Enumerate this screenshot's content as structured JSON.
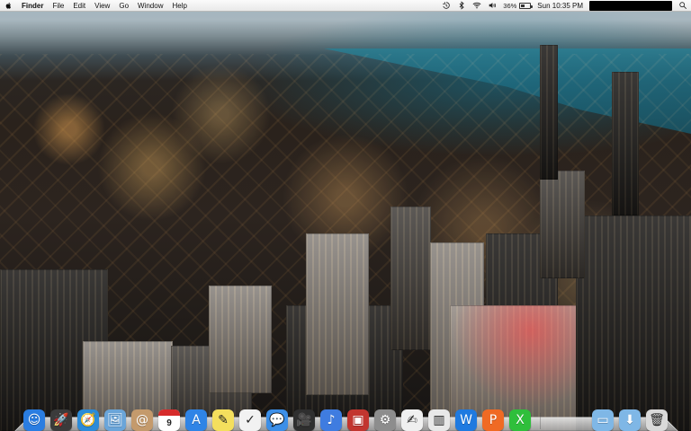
{
  "menubar": {
    "app_name": "Finder",
    "menus": [
      "File",
      "Edit",
      "View",
      "Go",
      "Window",
      "Help"
    ],
    "status": {
      "battery_percent_text": "36%",
      "battery_level": 0.36,
      "clock_text": "Sun 10:35 PM"
    },
    "icons": {
      "apple": "apple-menu-icon",
      "time_machine": "time-machine-icon",
      "bluetooth": "bluetooth-icon",
      "wifi": "wifi-icon",
      "volume": "volume-icon",
      "battery": "battery-icon",
      "spotlight": "spotlight-icon"
    }
  },
  "dock": {
    "left_items": [
      {
        "name": "finder-icon",
        "color": "#2a7de1",
        "glyph": "☺"
      },
      {
        "name": "launchpad-icon",
        "color": "#3b3b3b",
        "glyph": "🚀"
      },
      {
        "name": "safari-icon",
        "color": "#2b8bd9",
        "glyph": "🧭"
      },
      {
        "name": "preview-icon",
        "color": "#6aa5d9",
        "glyph": "🖼"
      },
      {
        "name": "contacts-icon",
        "color": "#c49a6c",
        "glyph": "@"
      },
      {
        "name": "calendar-icon",
        "color": "#ffffff",
        "glyph": "9"
      },
      {
        "name": "app-store-icon",
        "color": "#2f84e6",
        "glyph": "A"
      },
      {
        "name": "notes-icon",
        "color": "#f4df5d",
        "glyph": "✎"
      },
      {
        "name": "reminders-icon",
        "color": "#f2f2f2",
        "glyph": "✓"
      },
      {
        "name": "messages-icon",
        "color": "#3c8fe8",
        "glyph": "💬"
      },
      {
        "name": "facetime-icon",
        "color": "#2f2f2f",
        "glyph": "🎥"
      },
      {
        "name": "itunes-icon",
        "color": "#3f7ce0",
        "glyph": "♪"
      },
      {
        "name": "photo-booth-icon",
        "color": "#c2352f",
        "glyph": "▣"
      },
      {
        "name": "system-preferences-icon",
        "color": "#8d8d8d",
        "glyph": "⚙"
      },
      {
        "name": "textedit-icon",
        "color": "#f0f0f0",
        "glyph": "✍"
      },
      {
        "name": "keynote-icon",
        "color": "#e8e8e8",
        "glyph": "▥"
      },
      {
        "name": "microsoft-word-icon",
        "color": "#1f7ae0",
        "glyph": "W"
      },
      {
        "name": "microsoft-powerpoint-icon",
        "color": "#f06a24",
        "glyph": "P"
      },
      {
        "name": "microsoft-excel-icon",
        "color": "#2fbf3b",
        "glyph": "X"
      }
    ],
    "right_items": [
      {
        "name": "applications-folder-icon",
        "color": "#7fb7e6",
        "glyph": "▭"
      },
      {
        "name": "downloads-folder-icon",
        "color": "#7fb7e6",
        "glyph": "⬇"
      },
      {
        "name": "trash-icon",
        "color": "#d9d9d9",
        "glyph": "🗑"
      }
    ]
  }
}
